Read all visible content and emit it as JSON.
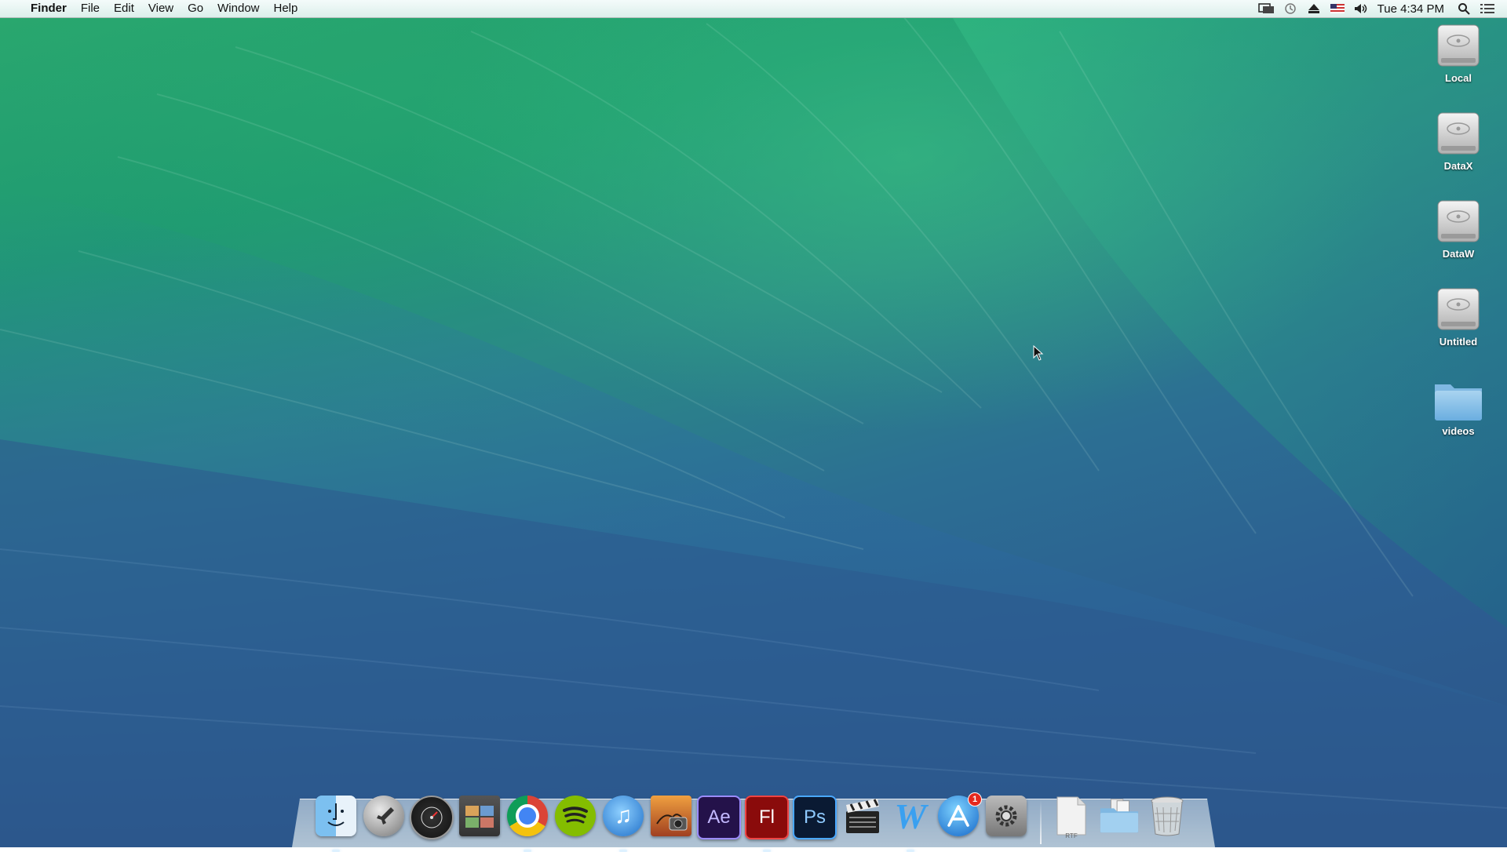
{
  "menubar": {
    "apple_glyph": "",
    "app_name": "Finder",
    "menus": [
      "File",
      "Edit",
      "View",
      "Go",
      "Window",
      "Help"
    ],
    "status_icons": [
      "display-mirroring-icon",
      "time-machine-icon",
      "eject-icon",
      "us-flag-icon",
      "volume-icon"
    ],
    "clock": "Tue 4:34 PM",
    "spotlight_icon": "search-icon",
    "notifications_icon": "list-icon"
  },
  "desktop_items": [
    {
      "label": "Local",
      "type": "drive"
    },
    {
      "label": "DataX",
      "type": "drive"
    },
    {
      "label": "DataW",
      "type": "drive"
    },
    {
      "label": "Untitled",
      "type": "drive"
    },
    {
      "label": "videos",
      "type": "folder"
    }
  ],
  "dock": {
    "apps": [
      {
        "name": "Finder",
        "icon": "finder-icon",
        "running": true
      },
      {
        "name": "Launchpad",
        "icon": "rocket-icon",
        "running": false
      },
      {
        "name": "Dashboard",
        "icon": "dashboard-icon",
        "running": false
      },
      {
        "name": "Preview",
        "icon": "preview-icon",
        "running": false
      },
      {
        "name": "Google Chrome",
        "icon": "chrome-icon",
        "running": true
      },
      {
        "name": "Spotify",
        "icon": "spotify-icon",
        "running": false
      },
      {
        "name": "iTunes",
        "icon": "itunes-icon",
        "running": true
      },
      {
        "name": "iPhoto",
        "icon": "iphoto-icon",
        "running": false
      },
      {
        "name": "After Effects",
        "icon": "after-effects-icon",
        "text": "Ae",
        "running": false
      },
      {
        "name": "Flash",
        "icon": "flash-icon",
        "text": "Fl",
        "running": true
      },
      {
        "name": "Photoshop",
        "icon": "photoshop-icon",
        "text": "Ps",
        "running": false
      },
      {
        "name": "Final Cut Pro",
        "icon": "clapperboard-icon",
        "running": false
      },
      {
        "name": "Word",
        "icon": "word-icon",
        "text": "W",
        "running": true
      },
      {
        "name": "App Store",
        "icon": "app-store-icon",
        "badge": "1",
        "running": false
      },
      {
        "name": "System Preferences",
        "icon": "gear-icon",
        "running": false
      }
    ],
    "stack_items": [
      {
        "name": "Document",
        "icon": "rtf-document-icon",
        "text": "RTF"
      },
      {
        "name": "Downloads",
        "icon": "folder-stack-icon"
      },
      {
        "name": "Trash",
        "icon": "trash-icon"
      }
    ]
  },
  "colors": {
    "wallpaper_top": "#2aa86e",
    "wallpaper_bottom": "#2b5488",
    "menubar_bg": "#e8f5f2",
    "badge_red": "#e6281e"
  }
}
